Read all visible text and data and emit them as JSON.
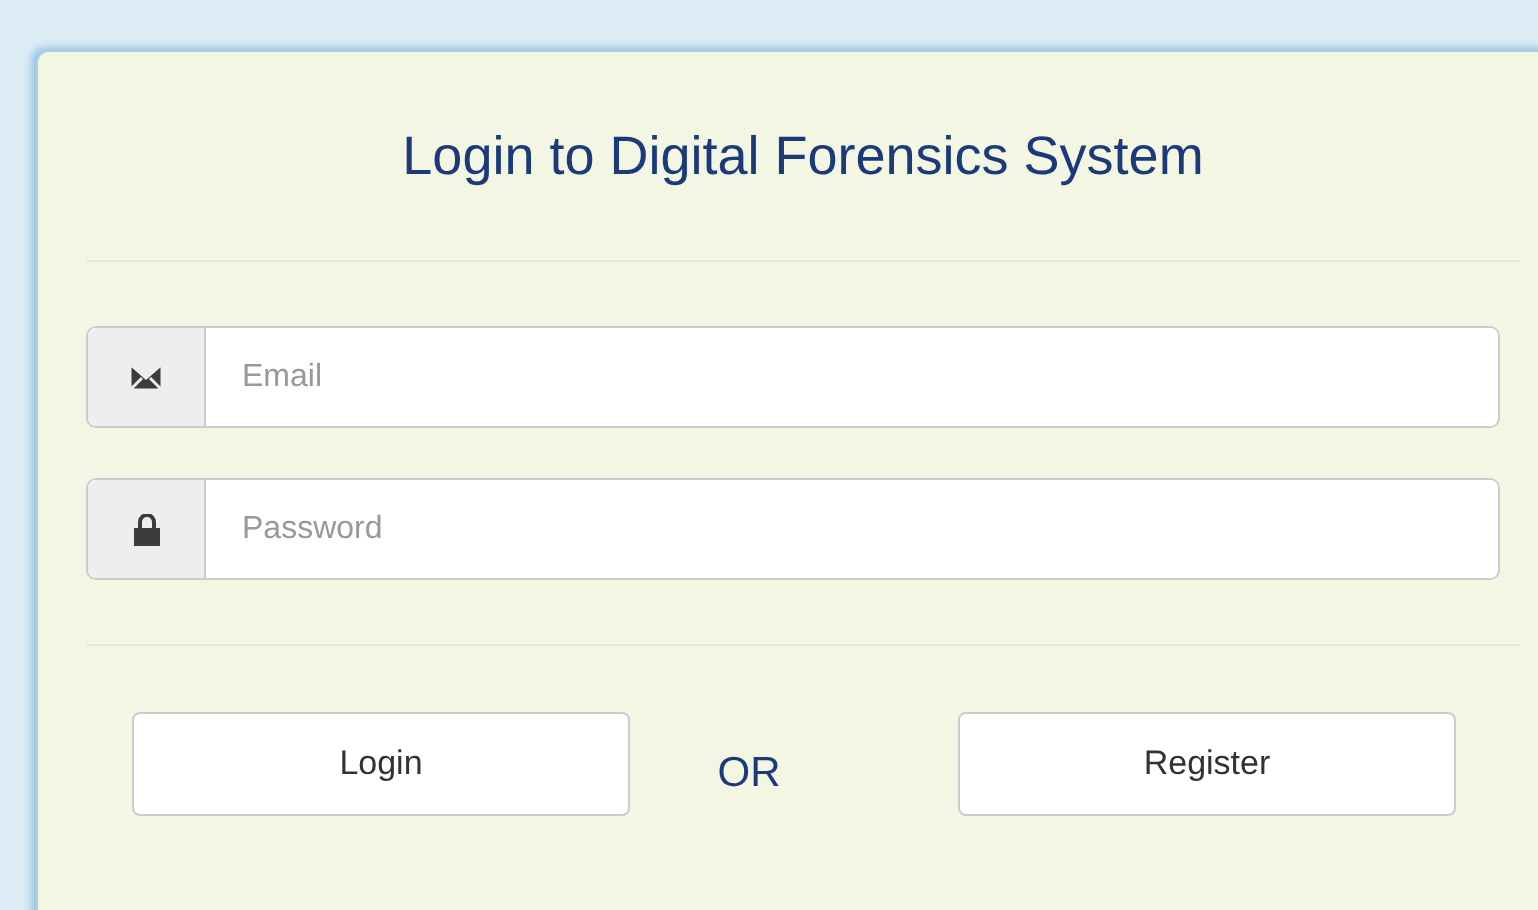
{
  "title": "Login to Digital Forensics System",
  "fields": [
    {
      "kind": "email",
      "placeholder": "Email"
    },
    {
      "kind": "password",
      "placeholder": "Password"
    }
  ],
  "actions": {
    "login": "Login",
    "separator": "OR",
    "register": "Register"
  }
}
